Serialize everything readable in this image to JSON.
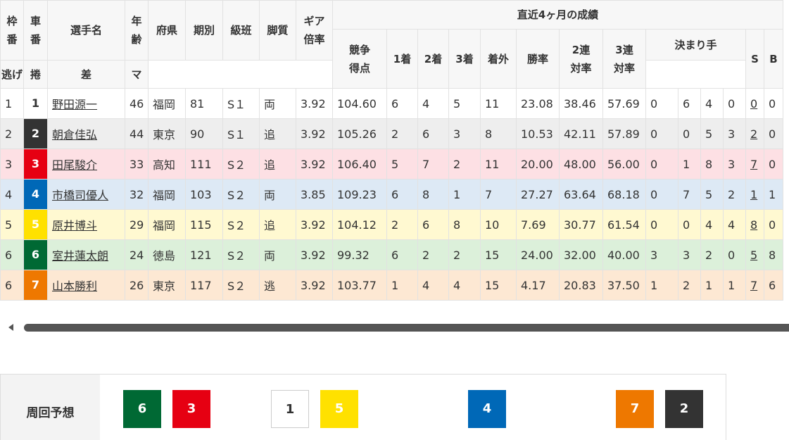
{
  "table": {
    "headers": {
      "waku": [
        "枠",
        "番"
      ],
      "car": [
        "車",
        "番"
      ],
      "name": "選手名",
      "age": [
        "年",
        "齢"
      ],
      "pref": "府県",
      "term": "期別",
      "class": "級班",
      "style": "脚質",
      "gear": [
        "ギア",
        "倍率"
      ],
      "recent": "直近4ヶ月の成績",
      "score": [
        "競争",
        "得点"
      ],
      "first": "1着",
      "second": "2着",
      "third": "3着",
      "out": "着外",
      "winrate": "勝率",
      "rentai2": [
        "2連",
        "対率"
      ],
      "rentai3": [
        "3連",
        "対率"
      ],
      "kimarite": "決まり手",
      "nige": "逃げ",
      "makuri": "捲",
      "sashi": "差",
      "ma": "マ",
      "s": "S",
      "b": "B"
    },
    "rows": [
      {
        "waku": "1",
        "car": "1",
        "color": "#ffffff",
        "name": "野田源一",
        "age": "46",
        "pref": "福岡",
        "term": "81",
        "class": "S１",
        "style": "両",
        "gear": "3.92",
        "score": "104.60",
        "first": "6",
        "second": "4",
        "third": "5",
        "out": "11",
        "winrate": "23.08",
        "r2": "38.46",
        "r3": "57.69",
        "nige": "0",
        "makuri": "6",
        "sashi": "4",
        "ma": "0",
        "s": "0",
        "b": "0"
      },
      {
        "waku": "2",
        "car": "2",
        "color": "#333333",
        "name": "朝倉佳弘",
        "age": "44",
        "pref": "東京",
        "term": "90",
        "class": "S１",
        "style": "追",
        "gear": "3.92",
        "score": "105.26",
        "first": "2",
        "second": "6",
        "third": "3",
        "out": "8",
        "winrate": "10.53",
        "r2": "42.11",
        "r3": "57.89",
        "nige": "0",
        "makuri": "0",
        "sashi": "5",
        "ma": "3",
        "s": "2",
        "b": "0"
      },
      {
        "waku": "3",
        "car": "3",
        "color": "#e60012",
        "name": "田尾駿介",
        "age": "33",
        "pref": "高知",
        "term": "111",
        "class": "S２",
        "style": "追",
        "gear": "3.92",
        "score": "106.40",
        "first": "5",
        "second": "7",
        "third": "2",
        "out": "11",
        "winrate": "20.00",
        "r2": "48.00",
        "r3": "56.00",
        "nige": "0",
        "makuri": "1",
        "sashi": "8",
        "ma": "3",
        "s": "7",
        "b": "0"
      },
      {
        "waku": "4",
        "car": "4",
        "color": "#0068b7",
        "name": "市橋司優人",
        "age": "32",
        "pref": "福岡",
        "term": "103",
        "class": "S２",
        "style": "両",
        "gear": "3.85",
        "score": "109.23",
        "first": "6",
        "second": "8",
        "third": "1",
        "out": "7",
        "winrate": "27.27",
        "r2": "63.64",
        "r3": "68.18",
        "nige": "0",
        "makuri": "7",
        "sashi": "5",
        "ma": "2",
        "s": "1",
        "b": "1"
      },
      {
        "waku": "5",
        "car": "5",
        "color": "#ffe100",
        "name": "原井博斗",
        "age": "29",
        "pref": "福岡",
        "term": "115",
        "class": "S２",
        "style": "追",
        "gear": "3.92",
        "score": "104.12",
        "first": "2",
        "second": "6",
        "third": "8",
        "out": "10",
        "winrate": "7.69",
        "r2": "30.77",
        "r3": "61.54",
        "nige": "0",
        "makuri": "0",
        "sashi": "4",
        "ma": "4",
        "s": "8",
        "b": "0"
      },
      {
        "waku": "6",
        "car": "6",
        "color": "#006934",
        "name": "室井蓮太朗",
        "age": "24",
        "pref": "徳島",
        "term": "121",
        "class": "S２",
        "style": "両",
        "gear": "3.92",
        "score": "99.32",
        "first": "6",
        "second": "2",
        "third": "2",
        "out": "15",
        "winrate": "24.00",
        "r2": "32.00",
        "r3": "40.00",
        "nige": "3",
        "makuri": "3",
        "sashi": "2",
        "ma": "0",
        "s": "5",
        "b": "8"
      },
      {
        "waku": "6",
        "car": "7",
        "color": "#ee7800",
        "name": "山本勝利",
        "age": "26",
        "pref": "東京",
        "term": "117",
        "class": "S２",
        "style": "逃",
        "gear": "3.92",
        "score": "103.77",
        "first": "1",
        "second": "4",
        "third": "4",
        "out": "15",
        "winrate": "4.17",
        "r2": "20.83",
        "r3": "37.50",
        "nige": "1",
        "makuri": "2",
        "sashi": "1",
        "ma": "1",
        "s": "7",
        "b": "6"
      }
    ]
  },
  "forecast": {
    "label": "周回予想",
    "cars": [
      "6",
      "3",
      "1",
      "5",
      "4",
      "7",
      "2"
    ]
  }
}
